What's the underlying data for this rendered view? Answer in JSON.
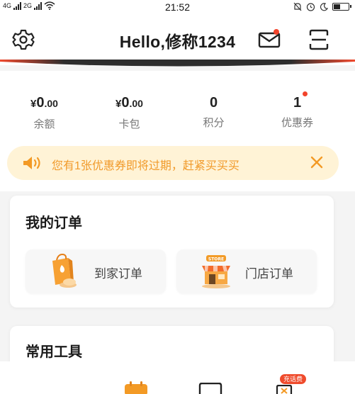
{
  "status_bar": {
    "network_left": "4G",
    "network_right": "2G",
    "time": "21:52"
  },
  "header": {
    "title": "Hello,修称1234"
  },
  "stats": [
    {
      "currency": "¥",
      "integer": "0",
      "decimal": ".00",
      "label": "余额"
    },
    {
      "currency": "¥",
      "integer": "0",
      "decimal": ".00",
      "label": "卡包"
    },
    {
      "currency": "",
      "integer": "0",
      "decimal": "",
      "label": "积分"
    },
    {
      "currency": "",
      "integer": "1",
      "decimal": "",
      "label": "优惠券"
    }
  ],
  "notice": {
    "text": "您有1张优惠券即将过期，赶紧买买买"
  },
  "orders": {
    "title": "我的订单",
    "home_label": "到家订单",
    "store_label": "门店订单",
    "store_sign": "STORE"
  },
  "tools": {
    "title": "常用工具",
    "badge": "充话费"
  },
  "colors": {
    "accent": "#f2442b",
    "notice_bg": "#fff3d6",
    "notice_text": "#f19a2a",
    "orange_icon": "#f39a25"
  },
  "icons": [
    "settings-icon",
    "mail-icon",
    "scan-icon",
    "speaker-icon",
    "close-icon",
    "shopping-bag-icon",
    "store-icon",
    "calendar-icon",
    "card-icon",
    "phone-icon"
  ]
}
